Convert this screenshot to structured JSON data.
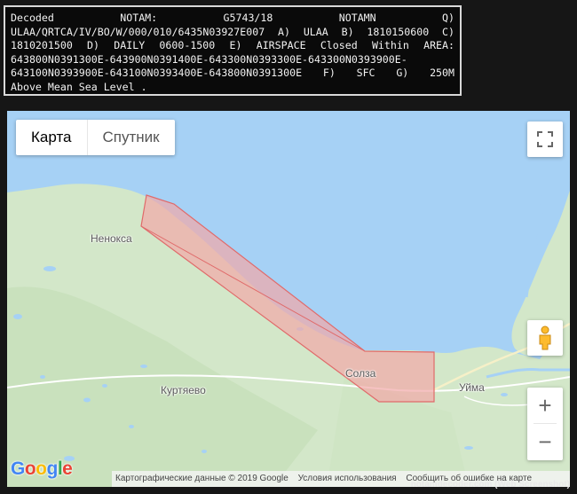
{
  "notam": {
    "lines": [
      "Decoded NOTAM: G5743/18 NOTAMN Q)",
      "ULAA/QRTCA/IV/BO/W/000/010/6435N03927E007 A) ULAA B) 1810150600 C)",
      "1810201500 D) DAILY 0600-1500 E) AIRSPACE Closed Within AREA:",
      "643800N0391300E-643900N0391400E-643300N0393300E-643300N0393900E-",
      "643100N0393900E-643100N0393400E-643800N0391300E F) SFC G) 250M",
      "Above Mean Sea Level ."
    ]
  },
  "map": {
    "map_type": {
      "map_label": "Карта",
      "satellite_label": "Спутник"
    },
    "places": {
      "nenoksa": "Ненокса",
      "kurtyaevo": "Куртяево",
      "solza": "Солза",
      "uyma": "Уйма"
    },
    "zoom": {
      "in_label": "+",
      "out_label": "−"
    },
    "google_logo": "Google",
    "attribution": {
      "data": "Картографические данные © 2019 Google",
      "terms": "Условия использования",
      "report": "Сообщить об ошибке на карте"
    },
    "colors": {
      "water": "#a6d1f5",
      "land": "#d3e7c9",
      "closed_area_fill": "#f2a8a8",
      "closed_area_stroke": "#e06a6a"
    }
  },
  "watermark": "notamdecoder.com (Web Screenshot)"
}
